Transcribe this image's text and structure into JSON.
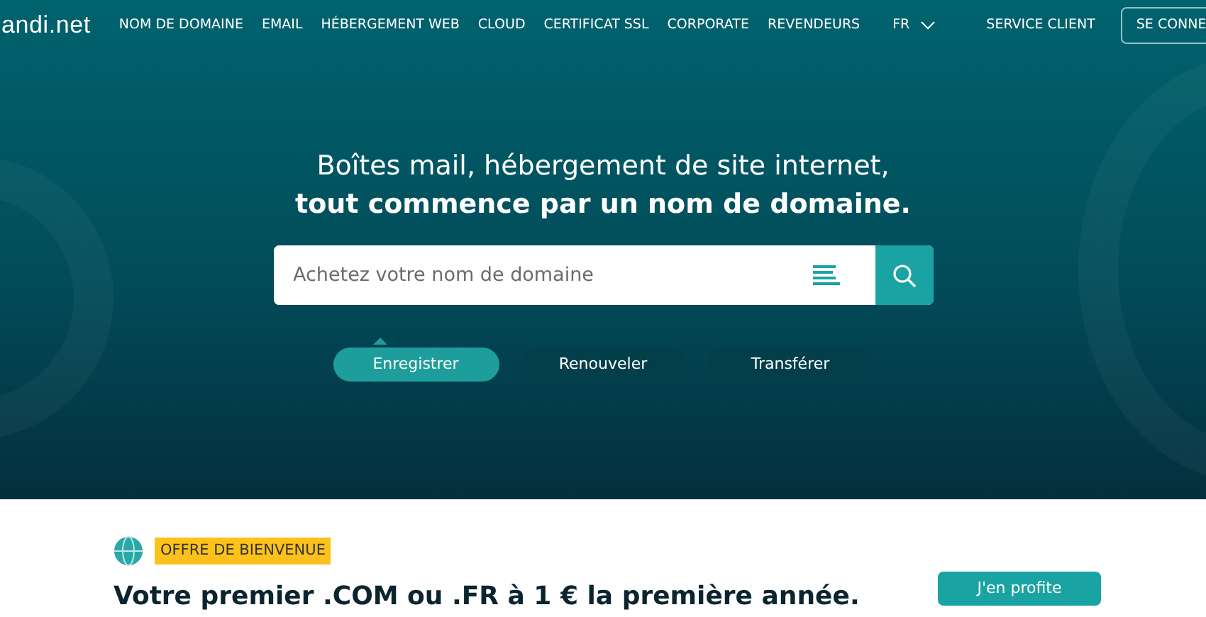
{
  "logo": "andi.net",
  "nav": [
    {
      "label": "NOM DE DOMAINE"
    },
    {
      "label": "EMAIL"
    },
    {
      "label": "HÉBERGEMENT WEB"
    },
    {
      "label": "CLOUD"
    },
    {
      "label": "CERTIFICAT SSL"
    },
    {
      "label": "CORPORATE"
    },
    {
      "label": "REVENDEURS"
    }
  ],
  "language": "FR",
  "support_link": "SERVICE CLIENT",
  "login_button": "SE CONNE",
  "hero": {
    "line1": "Boîtes mail, hébergement de site internet,",
    "line2": "tout commence par un nom de domaine.",
    "search": {
      "placeholder": "Achetez votre nom de domaine"
    },
    "tabs": [
      {
        "label": "Enregistrer",
        "selected": true
      },
      {
        "label": "Renouveler",
        "selected": false
      },
      {
        "label": "Transférer",
        "selected": false
      }
    ]
  },
  "offer": {
    "badge": "OFFRE DE BIENVENUE",
    "headline": "Votre premier .COM ou .FR à 1 € la première année.",
    "button": "J'en profite"
  }
}
